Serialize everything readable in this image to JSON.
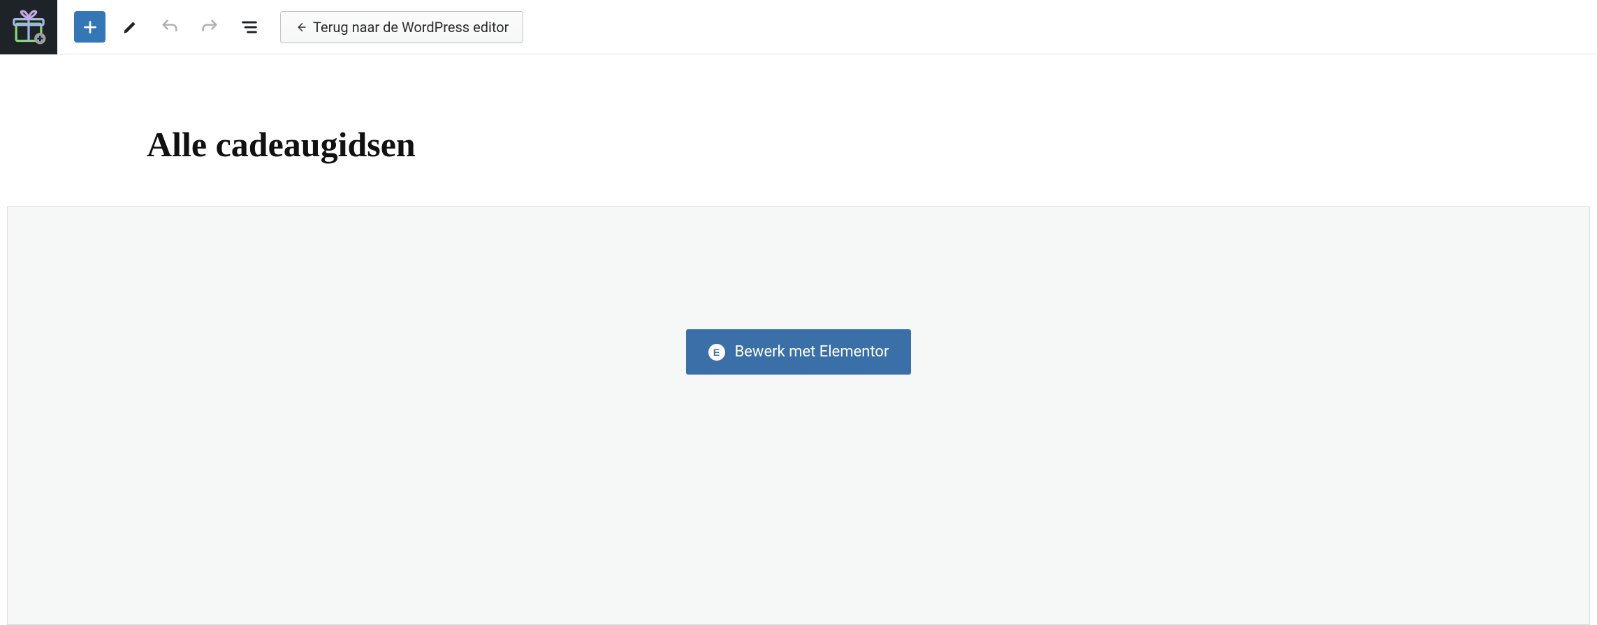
{
  "toolbar": {
    "back_label": "Terug naar de WordPress editor"
  },
  "page": {
    "title": "Alle cadeaugidsen"
  },
  "elementor": {
    "edit_label": "Bewerk met Elementor",
    "icon_glyph": "E"
  }
}
